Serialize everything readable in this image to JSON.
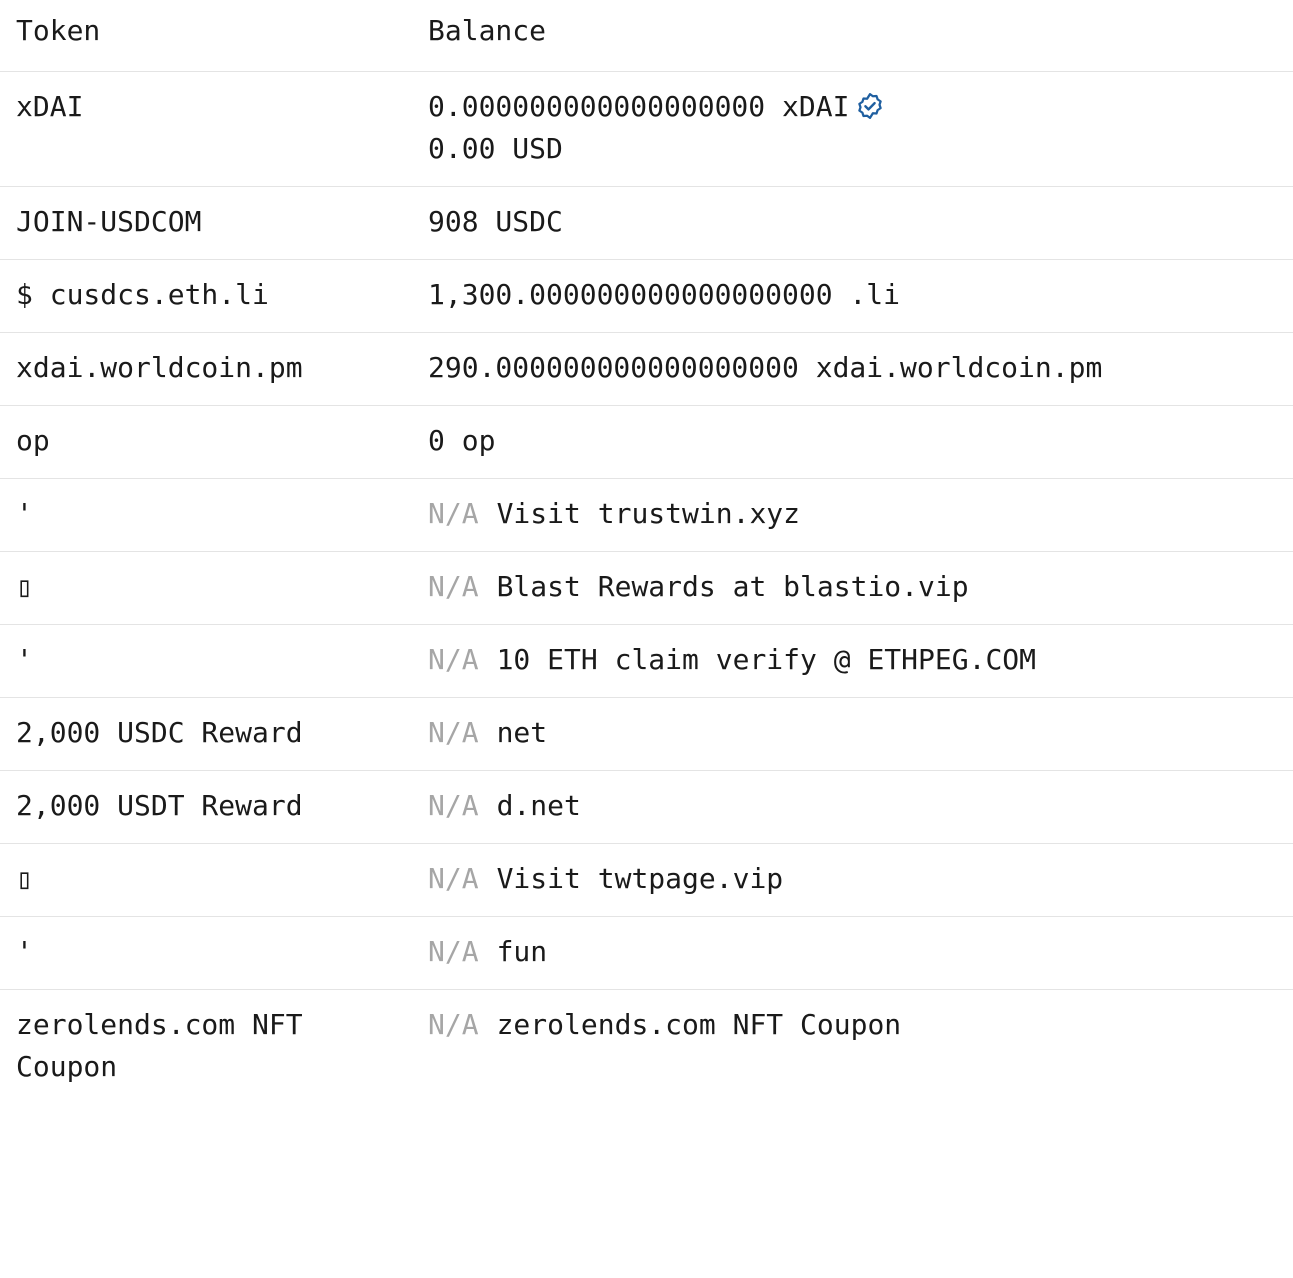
{
  "header": {
    "token": "Token",
    "balance": "Balance"
  },
  "na_label": "N/A",
  "accent_color": "#1f5fa0",
  "rows": [
    {
      "token": "xDAI",
      "balance": "0.000000000000000000 xDAI",
      "usd": "0.00 USD",
      "verified": true,
      "verified_icon": "verified-badge-icon"
    },
    {
      "token": "JOIN-USDCOM",
      "balance": "908 USDC"
    },
    {
      "token": "$ cusdcs.eth.li",
      "balance": "1,300.000000000000000000 .li"
    },
    {
      "token": "xdai.worldcoin.pm",
      "balance": "290.000000000000000000 xdai.worldcoin.pm"
    },
    {
      "token": "op",
      "balance": "0 op"
    },
    {
      "token": "'",
      "balance": "Visit trustwin.xyz"
    },
    {
      "token": "▯",
      "balance": "Blast Rewards at blastio.vip"
    },
    {
      "token": "'",
      "balance": "10 ETH claim verify @ ETHPEG.COM"
    },
    {
      "token": "2,000 USDC Reward",
      "balance": "net"
    },
    {
      "token": "2,000 USDT Reward",
      "balance": "d.net"
    },
    {
      "token": "▯",
      "balance": "Visit twtpage.vip"
    },
    {
      "token": "'",
      "balance": "fun"
    },
    {
      "token": "zerolends.com NFT Coupon",
      "balance": "zerolends.com NFT Coupon"
    }
  ]
}
